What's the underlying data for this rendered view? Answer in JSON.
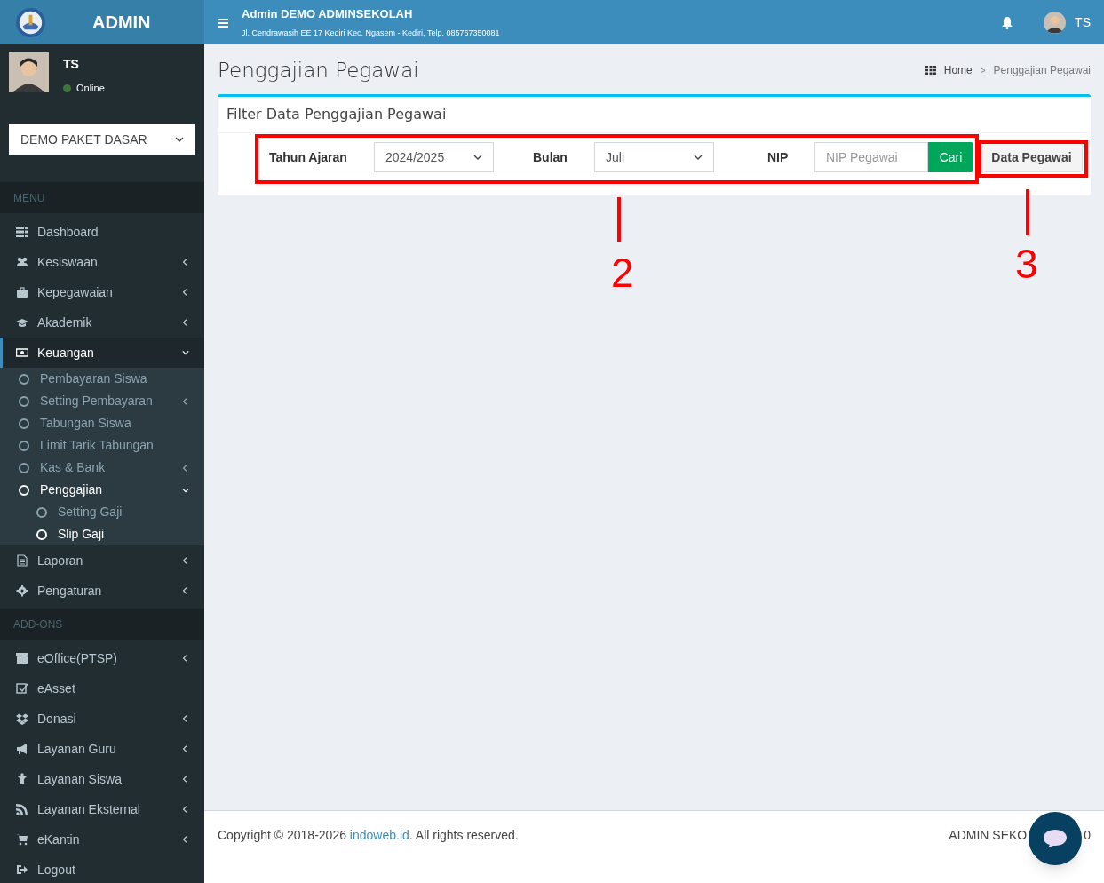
{
  "brand": {
    "title": "ADMIN"
  },
  "header": {
    "title": "Admin DEMO ADMINSEKOLAH",
    "address": "Jl. Cendrawasih EE 17 Kediri Kec. Ngasem - Kediri, Telp. 085767350081",
    "user": "TS"
  },
  "user_panel": {
    "name": "TS",
    "status": "Online"
  },
  "package_select": {
    "value": "DEMO PAKET DASAR"
  },
  "menu_sections": [
    {
      "title": "MENU",
      "items": [
        {
          "label": "Dashboard",
          "expandable": false,
          "selected": false
        },
        {
          "label": "Kesiswaan",
          "expandable": true,
          "expanded": false,
          "selected": false
        },
        {
          "label": "Kepegawaian",
          "expandable": true,
          "expanded": false,
          "selected": false
        },
        {
          "label": "Akademik",
          "expandable": true,
          "expanded": false,
          "selected": false
        },
        {
          "label": "Keuangan",
          "expandable": true,
          "expanded": true,
          "selected": true,
          "children": [
            {
              "label": "Pembayaran Siswa",
              "expandable": false,
              "selected": false
            },
            {
              "label": "Setting Pembayaran",
              "expandable": true,
              "expanded": false,
              "selected": false
            },
            {
              "label": "Tabungan Siswa",
              "expandable": false,
              "selected": false
            },
            {
              "label": "Limit Tarik Tabungan",
              "expandable": false,
              "selected": false
            },
            {
              "label": "Kas & Bank",
              "expandable": true,
              "expanded": false,
              "selected": false
            },
            {
              "label": "Penggajian",
              "expandable": true,
              "expanded": true,
              "selected": true,
              "children": [
                {
                  "label": "Setting Gaji",
                  "expandable": false,
                  "selected": false
                },
                {
                  "label": "Slip Gaji",
                  "expandable": false,
                  "selected": true
                }
              ]
            }
          ]
        },
        {
          "label": "Laporan",
          "expandable": true,
          "expanded": false,
          "selected": false
        },
        {
          "label": "Pengaturan",
          "expandable": true,
          "expanded": false,
          "selected": false
        }
      ]
    },
    {
      "title": "ADD-ONS",
      "items": [
        {
          "label": "eOffice(PTSP)",
          "expandable": true,
          "expanded": false,
          "selected": false
        },
        {
          "label": "eAsset",
          "expandable": false,
          "selected": false
        },
        {
          "label": "Donasi",
          "expandable": true,
          "expanded": false,
          "selected": false
        },
        {
          "label": "Layanan Guru",
          "expandable": true,
          "expanded": false,
          "selected": false
        },
        {
          "label": "Layanan Siswa",
          "expandable": true,
          "expanded": false,
          "selected": false
        },
        {
          "label": "Layanan Eksternal",
          "expandable": true,
          "expanded": false,
          "selected": false
        },
        {
          "label": "eKantin",
          "expandable": true,
          "expanded": false,
          "selected": false
        },
        {
          "label": "Logout",
          "expandable": false,
          "selected": false
        }
      ]
    }
  ],
  "page": {
    "title": "Penggajian Pegawai",
    "breadcrumb": [
      "Home",
      "Penggajian Pegawai"
    ],
    "breadcrumb_separator": ">"
  },
  "filter_card": {
    "title": "Filter Data Penggajian Pegawai",
    "tahun_ajaran": {
      "label": "Tahun Ajaran",
      "value": "2024/2025"
    },
    "bulan": {
      "label": "Bulan",
      "value": "Juli"
    },
    "nip": {
      "label": "NIP",
      "placeholder": "NIP Pegawai"
    },
    "search_button": "Cari",
    "employee_button": "Data Pegawai"
  },
  "annotations": [
    {
      "label": "2"
    },
    {
      "label": "3"
    }
  ],
  "footer": {
    "copyright_before": "Copyright © 2018-2026 ",
    "link": "indoweb.id",
    "copyright_after": ". All rights reserved.",
    "right_visible": [
      "ADMIN SEKO",
      "0"
    ]
  }
}
